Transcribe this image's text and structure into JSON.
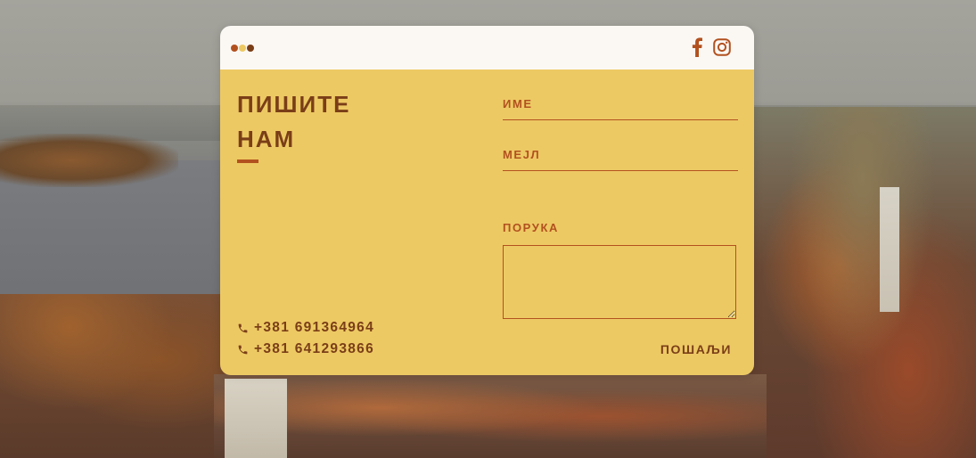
{
  "window": {
    "dot_colors": [
      "#b2511f",
      "#edc964",
      "#7a3e17"
    ],
    "social": [
      "facebook-icon",
      "instagram-icon"
    ],
    "icon_color": "#b2511f"
  },
  "contact": {
    "heading_line1": "ПИШИТЕ",
    "heading_line2": "НАМ",
    "phones": [
      "+381 691364964",
      "+381 641293866"
    ],
    "phone_icon": "phone-icon"
  },
  "form": {
    "name_label": "ИМЕ",
    "name_value": "",
    "email_label": "МЕЈЛ",
    "email_value": "",
    "message_label": "ПОРУКА",
    "message_value": "",
    "send_label": "ПОШАЉИ"
  },
  "colors": {
    "card_bg": "#edc964",
    "titlebar_bg": "#fbf8f4",
    "heading_text": "#7a3e17",
    "accent": "#b2511f"
  }
}
